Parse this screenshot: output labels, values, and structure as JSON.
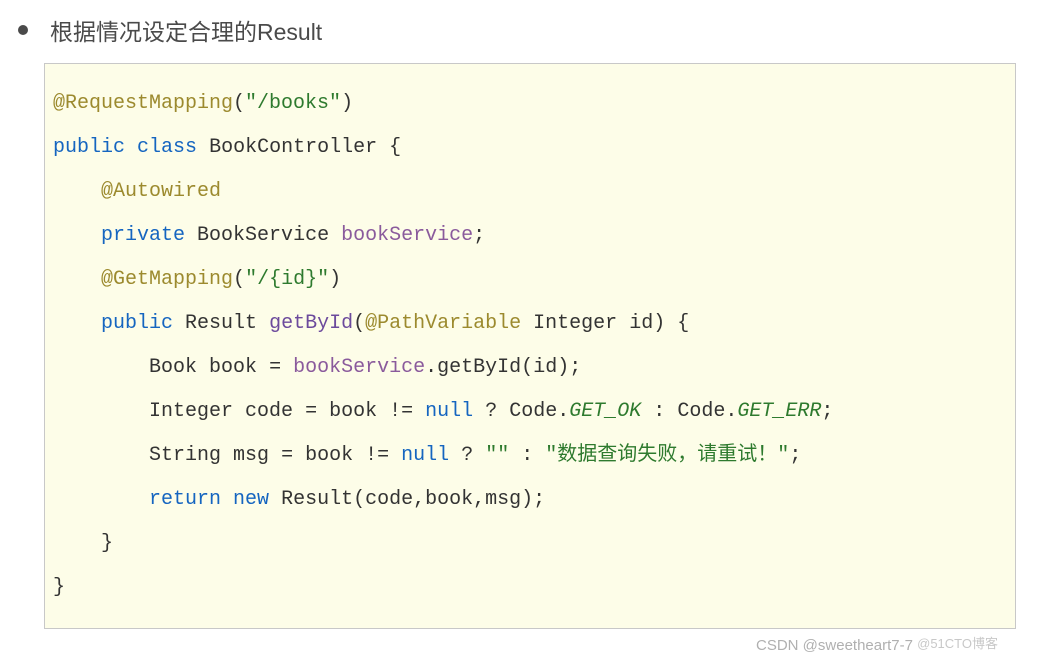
{
  "title": "根据情况设定合理的Result",
  "code": {
    "l1": {
      "ann": "@RequestMapping",
      "p1": "(",
      "str": "\"/books\"",
      "p2": ")"
    },
    "l2": {
      "kw1": "public",
      "kw2": "class",
      "cls": "BookController",
      "brace": "{"
    },
    "l3": {
      "ann": "@Autowired"
    },
    "l4": {
      "kw": "private",
      "type": "BookService",
      "field": "bookService",
      "semi": ";"
    },
    "l5": {
      "ann": "@GetMapping",
      "p1": "(",
      "str": "\"/{id}\"",
      "p2": ")"
    },
    "l6": {
      "kw": "public",
      "ret": "Result",
      "name": "getById",
      "p1": "(",
      "ann": "@PathVariable",
      "ptype": "Integer",
      "param": "id",
      "p2": ")",
      "brace": "{"
    },
    "l7": {
      "type": "Book",
      "var": "book",
      "eq": "=",
      "obj": "bookService",
      "dot": ".",
      "call": "getById",
      "p1": "(",
      "arg": "id",
      "p2": ");"
    },
    "l8": {
      "type": "Integer",
      "var": "code",
      "eq": "=",
      "v2": "book",
      "op": "!=",
      "nul": "null",
      "q": "?",
      "c1": "Code",
      "d1": ".",
      "ok": "GET_OK",
      "col": ":",
      "c2": "Code",
      "d2": ".",
      "err": "GET_ERR",
      "semi": ";"
    },
    "l9": {
      "type": "String",
      "var": "msg",
      "eq": "=",
      "v2": "book",
      "op": "!=",
      "nul": "null",
      "q": "?",
      "s1": "\"\"",
      "col": ":",
      "s2": "\"数据查询失败，请重试！\"",
      "semi": ";"
    },
    "l10": {
      "kw": "return",
      "kw2": "new",
      "cls": "Result",
      "args": "(code,book,msg);"
    },
    "l11": {
      "brace": "}"
    },
    "l12": {
      "brace": "}"
    }
  },
  "watermark": {
    "main": "CSDN @sweetheart7-7",
    "faint": "@51CTO博客"
  }
}
